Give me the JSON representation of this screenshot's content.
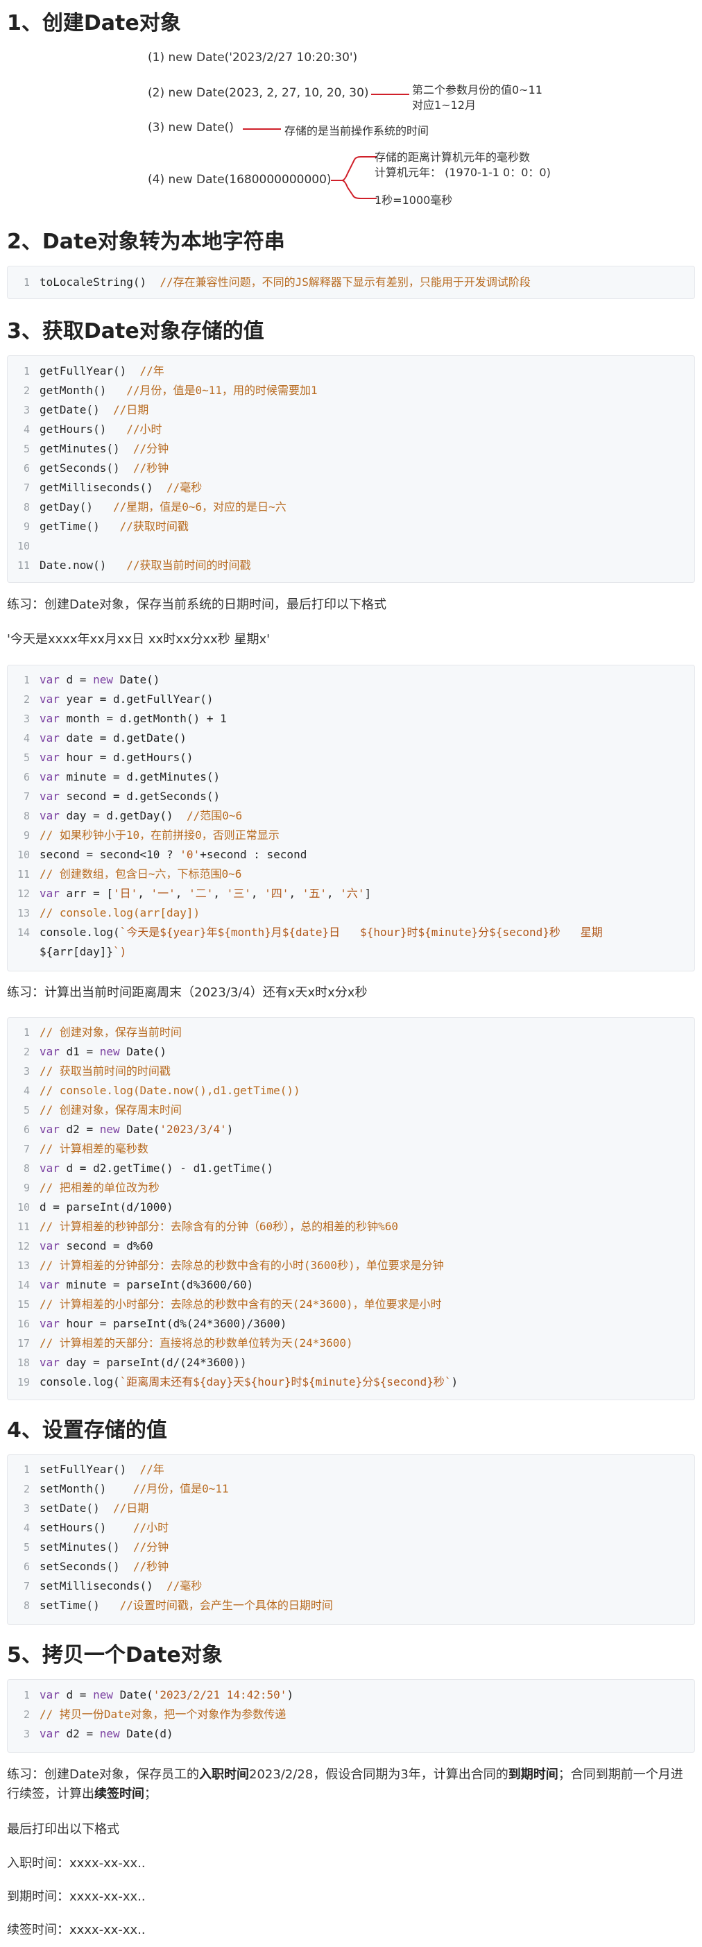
{
  "sections": {
    "s1": "1、创建Date对象",
    "s2": "2、Date对象转为本地字符串",
    "s3": "3、获取Date对象存储的值",
    "s4": "4、设置存储的值",
    "s5": "5、拷贝一个Date对象"
  },
  "diagram": {
    "item1": "(1)   new Date('2023/2/27 10:20:30')",
    "item2": "(2)  new Date(2023, 2, 27, 10, 20, 30)",
    "item2_note1": "第二个参数月份的值0~11",
    "item2_note2": "对应1~12月",
    "item3": "(3)  new Date()",
    "item3_note": "存储的是当前操作系统的时间",
    "item4": "(4)  new Date(1680000000000)",
    "item4_note1": "存储的距离计算机元年的毫秒数",
    "item4_note2": "计算机元年：  (1970-1-1 0：0：0)",
    "item4_note3": "1秒=1000毫秒"
  },
  "code2": [
    {
      "n": "1",
      "c": "toLocaleString()",
      "m": "  //存在兼容性问题，不同的JS解释器下显示有差别，只能用于开发调试阶段"
    }
  ],
  "code3": [
    {
      "n": "1",
      "c": "getFullYear()",
      "m": "  //年"
    },
    {
      "n": "2",
      "c": "getMonth()",
      "m": "   //月份，值是0~11，用的时候需要加1"
    },
    {
      "n": "3",
      "c": "getDate()",
      "m": "  //日期"
    },
    {
      "n": "4",
      "c": "getHours()",
      "m": "   //小时"
    },
    {
      "n": "5",
      "c": "getMinutes()",
      "m": "  //分钟"
    },
    {
      "n": "6",
      "c": "getSeconds()",
      "m": "  //秒钟"
    },
    {
      "n": "7",
      "c": "getMilliseconds()",
      "m": "  //毫秒"
    },
    {
      "n": "8",
      "c": "getDay()",
      "m": "   //星期，值是0~6，对应的是日~六"
    },
    {
      "n": "9",
      "c": "getTime()",
      "m": "   //获取时间戳"
    },
    {
      "n": "10",
      "c": "",
      "m": ""
    },
    {
      "n": "11",
      "c": "Date.now()",
      "m": "   //获取当前时间的时间戳"
    }
  ],
  "practice1": "练习：创建Date对象，保存当前系统的日期时间，最后打印以下格式",
  "practice1_format": "'今天是xxxx年xx月xx日  xx时xx分xx秒  星期x'",
  "code4": [
    {
      "n": "1",
      "k": "var ",
      "c": "d = ",
      "k2": "new ",
      "c2": "Date()",
      "m": ""
    },
    {
      "n": "2",
      "k": "var ",
      "c": "year = d.getFullYear()",
      "k2": "",
      "c2": "",
      "m": ""
    },
    {
      "n": "3",
      "k": "var ",
      "c": "month = d.getMonth() + 1",
      "k2": "",
      "c2": "",
      "m": ""
    },
    {
      "n": "4",
      "k": "var ",
      "c": "date = d.getDate()",
      "k2": "",
      "c2": "",
      "m": ""
    },
    {
      "n": "5",
      "k": "var ",
      "c": "hour = d.getHours()",
      "k2": "",
      "c2": "",
      "m": ""
    },
    {
      "n": "6",
      "k": "var ",
      "c": "minute = d.getMinutes()",
      "k2": "",
      "c2": "",
      "m": ""
    },
    {
      "n": "7",
      "k": "var ",
      "c": "second = d.getSeconds()",
      "k2": "",
      "c2": "",
      "m": ""
    },
    {
      "n": "8",
      "k": "var ",
      "c": "day = d.getDay()",
      "k2": "",
      "c2": "",
      "m": "  //范围0~6"
    },
    {
      "n": "9",
      "k": "",
      "c": "",
      "k2": "",
      "c2": "",
      "m": "// 如果秒钟小于10，在前拼接0，否则正常显示"
    },
    {
      "n": "10",
      "k": "",
      "c": "second = second<10 ? '0'+second : second",
      "k2": "",
      "c2": "",
      "m": ""
    },
    {
      "n": "11",
      "k": "",
      "c": "",
      "k2": "",
      "c2": "",
      "m": "// 创建数组，包含日~六，下标范围0~6"
    },
    {
      "n": "12",
      "k": "var ",
      "c": "arr = ['日', '一', '二', '三', '四', '五', '六']",
      "k2": "",
      "c2": "",
      "m": ""
    },
    {
      "n": "13",
      "k": "",
      "c": "",
      "k2": "",
      "c2": "",
      "m": "// console.log(arr[day])"
    },
    {
      "n": "14",
      "k": "",
      "c": "console.log(`今天是${year}年${month}月${date}日   ${hour}时${minute}分${second}秒   星期",
      "k2": "",
      "c2": "",
      "m": ""
    },
    {
      "n": "",
      "k": "",
      "c": "${arr[day]}`)",
      "k2": "",
      "c2": "",
      "m": ""
    }
  ],
  "practice2": "练习：计算出当前时间距离周末（2023/3/4）还有x天x时x分x秒",
  "code5": [
    {
      "n": "1",
      "c": "",
      "m": "// 创建对象，保存当前时间"
    },
    {
      "n": "2",
      "c": "var d1 = new Date()",
      "m": ""
    },
    {
      "n": "3",
      "c": "",
      "m": "// 获取当前时间的时间戳"
    },
    {
      "n": "4",
      "c": "",
      "m": "// console.log(Date.now(),d1.getTime())"
    },
    {
      "n": "5",
      "c": "",
      "m": "// 创建对象，保存周末时间"
    },
    {
      "n": "6",
      "c": "var d2 = new Date('2023/3/4')",
      "m": ""
    },
    {
      "n": "7",
      "c": "",
      "m": "// 计算相差的毫秒数"
    },
    {
      "n": "8",
      "c": "var d = d2.getTime() - d1.getTime()",
      "m": ""
    },
    {
      "n": "9",
      "c": "",
      "m": "// 把相差的单位改为秒"
    },
    {
      "n": "10",
      "c": "d = parseInt(d/1000)",
      "m": ""
    },
    {
      "n": "11",
      "c": "",
      "m": "// 计算相差的秒钟部分：去除含有的分钟（60秒），总的相差的秒钟%60"
    },
    {
      "n": "12",
      "c": "var second = d%60",
      "m": ""
    },
    {
      "n": "13",
      "c": "",
      "m": "// 计算相差的分钟部分：去除总的秒数中含有的小时(3600秒)，单位要求是分钟"
    },
    {
      "n": "14",
      "c": "var minute = parseInt(d%3600/60)",
      "m": ""
    },
    {
      "n": "15",
      "c": "",
      "m": "// 计算相差的小时部分：去除总的秒数中含有的天(24*3600)，单位要求是小时"
    },
    {
      "n": "16",
      "c": "var hour = parseInt(d%(24*3600)/3600)",
      "m": ""
    },
    {
      "n": "17",
      "c": "",
      "m": "// 计算相差的天部分：直接将总的秒数单位转为天(24*3600)"
    },
    {
      "n": "18",
      "c": "var day = parseInt(d/(24*3600))",
      "m": ""
    },
    {
      "n": "19",
      "c": "console.log(`距离周末还有${day}天${hour}时${minute}分${second}秒`)",
      "m": ""
    }
  ],
  "code6": [
    {
      "n": "1",
      "c": "setFullYear()",
      "m": "  //年"
    },
    {
      "n": "2",
      "c": "setMonth()",
      "m": "    //月份，值是0~11"
    },
    {
      "n": "3",
      "c": "setDate()",
      "m": "  //日期"
    },
    {
      "n": "4",
      "c": "setHours()",
      "m": "    //小时"
    },
    {
      "n": "5",
      "c": "setMinutes()",
      "m": "  //分钟"
    },
    {
      "n": "6",
      "c": "setSeconds()",
      "m": "  //秒钟"
    },
    {
      "n": "7",
      "c": "setMilliseconds()",
      "m": "  //毫秒"
    },
    {
      "n": "8",
      "c": "setTime()",
      "m": "   //设置时间戳，会产生一个具体的日期时间"
    }
  ],
  "code7": [
    {
      "n": "1",
      "c": "var d = new Date('2023/2/21 14:42:50')",
      "m": ""
    },
    {
      "n": "2",
      "c": "",
      "m": "// 拷贝一份Date对象，把一个对象作为参数传递"
    },
    {
      "n": "3",
      "c": "var d2 = new Date(d)",
      "m": ""
    }
  ],
  "practice3": {
    "p1": "练习：创建Date对象，保存员工的",
    "b1": "入职时间",
    "p2": "2023/2/28，假设合同期为3年，计算出合同的",
    "b2": "到期时间",
    "p3": "；合同到期前一个月进行续签，计算出",
    "b3": "续签时间",
    "p4": "；"
  },
  "practice3_format": "最后打印出以下格式",
  "out1": "入职时间：xxxx-xx-xx..",
  "out2": "到期时间：xxxx-xx-xx..",
  "out3": "续签时间：xxxx-xx-xx.."
}
